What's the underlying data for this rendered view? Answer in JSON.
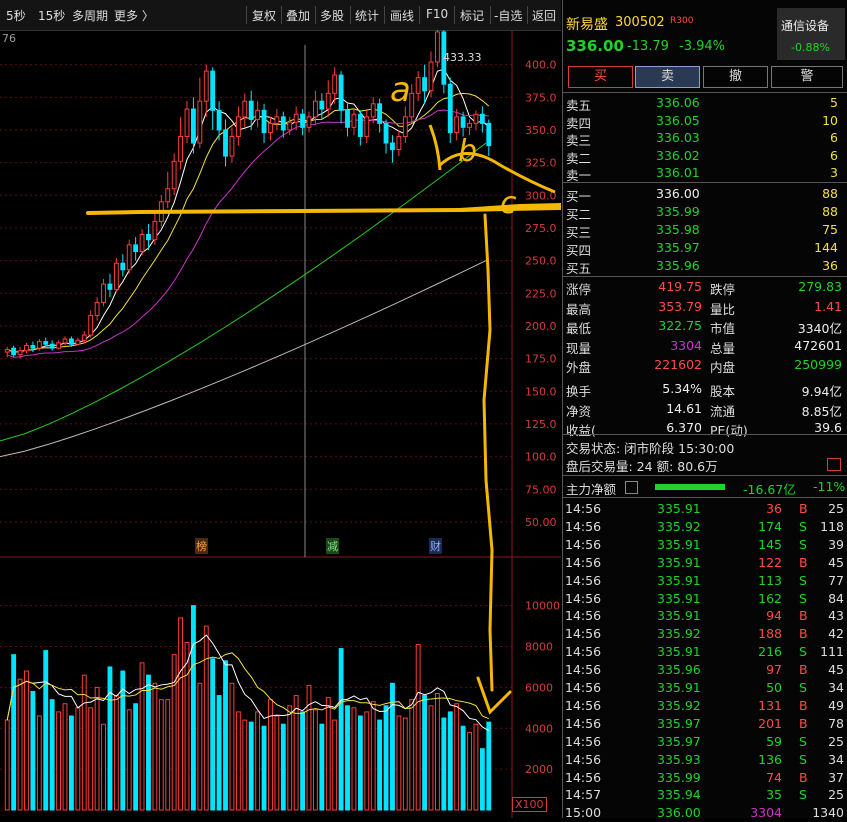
{
  "toolbar": {
    "corner": "5秒",
    "items": [
      "15秒",
      "多周期",
      "更多 〉"
    ],
    "tools": [
      "复权",
      "叠加",
      "多股",
      "统计",
      "画线",
      "F10",
      "标记",
      "-自选",
      "返回"
    ]
  },
  "chart": {
    "axis_corner": "76",
    "price_ticks": [
      "400.0",
      "375.0",
      "350.0",
      "325.0",
      "300.0",
      "275.0",
      "250.0",
      "225.0",
      "200.0",
      "175.0",
      "150.0",
      "125.0",
      "100.0",
      "75.00",
      "50.00"
    ],
    "volume_ticks": [
      "10000",
      "8000",
      "6000",
      "4000",
      "2000"
    ],
    "volume_unit": "X100",
    "high_marker": "433.33",
    "event_tags": [
      "榜",
      "减",
      "财"
    ],
    "handwriting": [
      "a",
      "b",
      "c"
    ]
  },
  "chart_data": {
    "type": "candlestick",
    "ylim": [
      40,
      415
    ],
    "volume_ylim": [
      0,
      11500
    ],
    "candles": [
      [
        180,
        182,
        176,
        184,
        173,
        "d"
      ],
      [
        183,
        178,
        176,
        185,
        "u"
      ],
      [
        178,
        181,
        175,
        184,
        "u"
      ],
      [
        181,
        185,
        179,
        187,
        "u"
      ],
      [
        185,
        183,
        180,
        188,
        "d"
      ],
      [
        183,
        188,
        181,
        190,
        "u"
      ],
      [
        188,
        186,
        184,
        191,
        "d"
      ],
      [
        186,
        183,
        181,
        189,
        "d"
      ],
      [
        183,
        187,
        182,
        189,
        "u"
      ],
      [
        187,
        190,
        185,
        192,
        "u"
      ],
      [
        190,
        186,
        184,
        192,
        "d"
      ],
      [
        186,
        189,
        185,
        191,
        "u"
      ],
      [
        189,
        193,
        187,
        196,
        "u"
      ],
      [
        193,
        208,
        191,
        212,
        "u"
      ],
      [
        208,
        218,
        204,
        222,
        "u"
      ],
      [
        218,
        232,
        215,
        236,
        "u"
      ],
      [
        232,
        228,
        222,
        240,
        "d"
      ],
      [
        228,
        248,
        226,
        252,
        "u"
      ],
      [
        248,
        243,
        238,
        255,
        "d"
      ],
      [
        243,
        262,
        240,
        266,
        "u"
      ],
      [
        262,
        257,
        250,
        268,
        "d"
      ],
      [
        257,
        270,
        254,
        274,
        "u"
      ],
      [
        270,
        266,
        258,
        278,
        "d"
      ],
      [
        266,
        280,
        262,
        286,
        "u"
      ],
      [
        280,
        295,
        276,
        300,
        "u"
      ],
      [
        295,
        305,
        290,
        318,
        "u"
      ],
      [
        305,
        326,
        300,
        332,
        "u"
      ],
      [
        326,
        345,
        320,
        360,
        "u"
      ],
      [
        345,
        366,
        340,
        372,
        "u"
      ],
      [
        366,
        340,
        332,
        375,
        "d"
      ],
      [
        340,
        372,
        336,
        390,
        "u"
      ],
      [
        372,
        395,
        360,
        400,
        "u"
      ],
      [
        395,
        365,
        350,
        398,
        "d"
      ],
      [
        365,
        350,
        342,
        372,
        "d"
      ],
      [
        350,
        330,
        322,
        358,
        "d"
      ],
      [
        330,
        345,
        325,
        352,
        "u"
      ],
      [
        345,
        360,
        338,
        368,
        "u"
      ],
      [
        360,
        372,
        352,
        378,
        "u"
      ],
      [
        372,
        358,
        350,
        380,
        "d"
      ],
      [
        358,
        365,
        352,
        372,
        "u"
      ],
      [
        365,
        348,
        340,
        370,
        "d"
      ],
      [
        348,
        355,
        342,
        360,
        "u"
      ],
      [
        355,
        360,
        350,
        366,
        "u"
      ],
      [
        360,
        350,
        344,
        364,
        "d"
      ],
      [
        350,
        356,
        346,
        360,
        "u"
      ],
      [
        356,
        362,
        350,
        368,
        "u"
      ],
      [
        362,
        352,
        346,
        366,
        "d"
      ],
      [
        352,
        360,
        348,
        364,
        "u"
      ],
      [
        360,
        372,
        355,
        380,
        "u"
      ],
      [
        372,
        366,
        358,
        378,
        "d"
      ],
      [
        366,
        378,
        360,
        388,
        "u"
      ],
      [
        378,
        392,
        370,
        398,
        "u"
      ],
      [
        392,
        365,
        355,
        395,
        "d"
      ],
      [
        365,
        352,
        345,
        370,
        "d"
      ],
      [
        352,
        362,
        346,
        366,
        "u"
      ],
      [
        362,
        345,
        338,
        365,
        "d"
      ],
      [
        345,
        360,
        340,
        366,
        "u"
      ],
      [
        360,
        370,
        355,
        375,
        "u"
      ],
      [
        370,
        355,
        348,
        374,
        "d"
      ],
      [
        355,
        340,
        332,
        358,
        "d"
      ],
      [
        340,
        335,
        325,
        346,
        "d"
      ],
      [
        335,
        345,
        330,
        350,
        "u"
      ],
      [
        345,
        360,
        340,
        368,
        "u"
      ],
      [
        360,
        378,
        355,
        385,
        "u"
      ],
      [
        378,
        390,
        372,
        395,
        "u"
      ],
      [
        390,
        380,
        370,
        400,
        "d"
      ],
      [
        380,
        402,
        375,
        410,
        "u"
      ],
      [
        402,
        425,
        398,
        433.33,
        "u"
      ],
      [
        425,
        385,
        378,
        428,
        "d"
      ],
      [
        385,
        348,
        340,
        390,
        "d"
      ],
      [
        348,
        360,
        342,
        366,
        "u"
      ],
      [
        360,
        352,
        345,
        364,
        "d"
      ],
      [
        352,
        355,
        346,
        358,
        "u"
      ],
      [
        355,
        362,
        350,
        365,
        "u"
      ],
      [
        362,
        355,
        348,
        368,
        "d"
      ],
      [
        355,
        338,
        330,
        358,
        "d"
      ]
    ],
    "volumes": [
      4400,
      7600,
      6400,
      6800,
      5800,
      4600,
      7800,
      5400,
      4800,
      5200,
      4600,
      5000,
      6600,
      5000,
      6000,
      4200,
      7000,
      5600,
      6800,
      4900,
      5200,
      7200,
      6600,
      6200,
      5400,
      5400,
      7600,
      9400,
      8200,
      10000,
      6200,
      9000,
      7400,
      5600,
      7300,
      6200,
      4800,
      4400,
      4300,
      4800,
      4100,
      5400,
      4600,
      4200,
      5100,
      5600,
      4800,
      6100,
      4900,
      4200,
      5500,
      4400,
      7900,
      5100,
      5000,
      4600,
      4800,
      5300,
      4400,
      5100,
      6200,
      4600,
      4500,
      5400,
      8100,
      5600,
      5100,
      5700,
      4500,
      4800,
      5200,
      4100,
      3800,
      4200,
      3000,
      4300
    ]
  },
  "quote": {
    "name": "新易盛",
    "code": "300502",
    "badge": "R300",
    "price": "336.00",
    "change": "-13.79",
    "change_pct": "-3.94%",
    "sector_name": "通信设备",
    "sector_pct": "-0.88%",
    "buttons": [
      "买",
      "卖",
      "撤",
      "警"
    ]
  },
  "orderbook": {
    "asks": [
      {
        "label": "卖五",
        "price": "336.06",
        "qty": "5"
      },
      {
        "label": "卖四",
        "price": "336.05",
        "qty": "10"
      },
      {
        "label": "卖三",
        "price": "336.03",
        "qty": "6"
      },
      {
        "label": "卖二",
        "price": "336.02",
        "qty": "6"
      },
      {
        "label": "卖一",
        "price": "336.01",
        "qty": "3"
      }
    ],
    "bids": [
      {
        "label": "买一",
        "price": "336.00",
        "qty": "88"
      },
      {
        "label": "买二",
        "price": "335.99",
        "qty": "88"
      },
      {
        "label": "买三",
        "price": "335.98",
        "qty": "75"
      },
      {
        "label": "买四",
        "price": "335.97",
        "qty": "144"
      },
      {
        "label": "买五",
        "price": "335.96",
        "qty": "36"
      }
    ]
  },
  "stats": [
    {
      "l1": "涨停",
      "v1": "419.75",
      "l2": "跌停",
      "v2": "279.83",
      "c1": "red",
      "c2": "grn"
    },
    {
      "l1": "最高",
      "v1": "353.79",
      "l2": "量比",
      "v2": "1.41",
      "c1": "red",
      "c2": "red"
    },
    {
      "l1": "最低",
      "v1": "322.75",
      "l2": "市值",
      "v2": "3340亿",
      "c1": "grn",
      "c2": "wht"
    },
    {
      "l1": "现量",
      "v1": "3304",
      "l2": "总量",
      "v2": "472601",
      "c1": "mag",
      "c2": "wht"
    },
    {
      "l1": "外盘",
      "v1": "221602",
      "l2": "内盘",
      "v2": "250999",
      "c1": "red",
      "c2": "grn"
    },
    {
      "l1": "换手",
      "v1": "5.34%",
      "l2": "股本",
      "v2": "9.94亿",
      "c1": "wht",
      "c2": "wht"
    },
    {
      "l1": "净资",
      "v1": "14.61",
      "l2": "流通",
      "v2": "8.85亿",
      "c1": "wht",
      "c2": "wht"
    },
    {
      "l1": "收益(",
      "v1": "6.370",
      "l2": "PE(动)",
      "v2": "39.6",
      "c1": "wht",
      "c2": "wht"
    }
  ],
  "status": {
    "trade_state": "交易状态: 闭市阶段 15:30:00",
    "after_hours": "盘后交易量: 24  额: 80.6万"
  },
  "main_flow": {
    "label": "主力净额",
    "value": "-16.67亿",
    "pct": "-11%"
  },
  "ticks": [
    {
      "t": "14:56",
      "p": "335.91",
      "v": "36",
      "s": "B",
      "n": "25"
    },
    {
      "t": "14:56",
      "p": "335.92",
      "v": "174",
      "s": "S",
      "n": "118"
    },
    {
      "t": "14:56",
      "p": "335.91",
      "v": "145",
      "s": "S",
      "n": "39"
    },
    {
      "t": "14:56",
      "p": "335.91",
      "v": "122",
      "s": "B",
      "n": "45"
    },
    {
      "t": "14:56",
      "p": "335.91",
      "v": "113",
      "s": "S",
      "n": "77"
    },
    {
      "t": "14:56",
      "p": "335.91",
      "v": "162",
      "s": "S",
      "n": "84"
    },
    {
      "t": "14:56",
      "p": "335.91",
      "v": "94",
      "s": "B",
      "n": "43"
    },
    {
      "t": "14:56",
      "p": "335.92",
      "v": "188",
      "s": "B",
      "n": "42"
    },
    {
      "t": "14:56",
      "p": "335.91",
      "v": "216",
      "s": "S",
      "n": "111"
    },
    {
      "t": "14:56",
      "p": "335.96",
      "v": "97",
      "s": "B",
      "n": "45"
    },
    {
      "t": "14:56",
      "p": "335.91",
      "v": "50",
      "s": "S",
      "n": "34"
    },
    {
      "t": "14:56",
      "p": "335.92",
      "v": "131",
      "s": "B",
      "n": "49"
    },
    {
      "t": "14:56",
      "p": "335.97",
      "v": "201",
      "s": "B",
      "n": "78"
    },
    {
      "t": "14:56",
      "p": "335.97",
      "v": "59",
      "s": "S",
      "n": "25"
    },
    {
      "t": "14:56",
      "p": "335.93",
      "v": "136",
      "s": "S",
      "n": "34"
    },
    {
      "t": "14:56",
      "p": "335.99",
      "v": "74",
      "s": "B",
      "n": "37"
    },
    {
      "t": "14:57",
      "p": "335.94",
      "v": "35",
      "s": "S",
      "n": "25"
    },
    {
      "t": "15:00",
      "p": "336.00",
      "v": "3304",
      "s": "",
      "n": "1340"
    }
  ],
  "colors": {
    "up": "#ff3b3b",
    "down": "#00e5ff",
    "ma5": "#ffffff",
    "ma10": "#f0e040",
    "ma20": "#cc33cc",
    "ma60": "#22cc22",
    "ma120": "#bbbbbb",
    "annotation": "#f5b800"
  }
}
